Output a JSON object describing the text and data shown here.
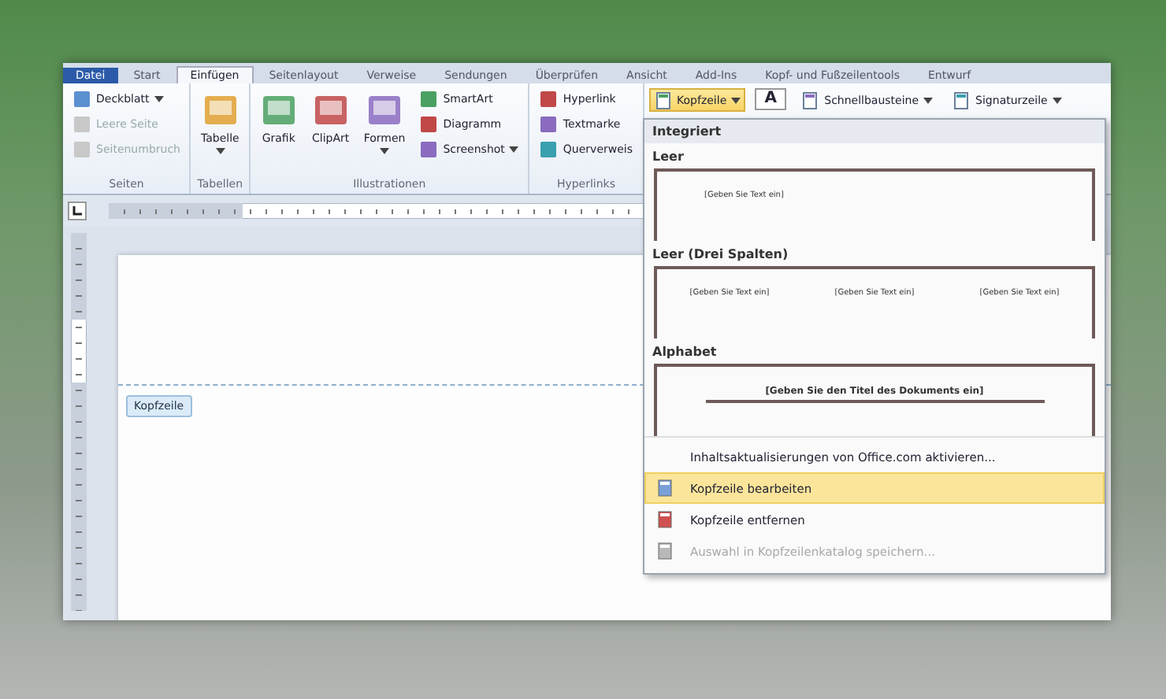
{
  "tabs": [
    {
      "label": "Datei",
      "selected": false
    },
    {
      "label": "Start",
      "selected": false
    },
    {
      "label": "Einfügen",
      "selected": true
    },
    {
      "label": "Seitenlayout",
      "selected": false
    },
    {
      "label": "Verweise",
      "selected": false
    },
    {
      "label": "Sendungen",
      "selected": false
    },
    {
      "label": "Überprüfen",
      "selected": false
    },
    {
      "label": "Ansicht",
      "selected": false
    },
    {
      "label": "Add-Ins",
      "selected": false
    },
    {
      "label": "Kopf- und Fußzeilentools",
      "selected": false
    },
    {
      "label": "Entwurf",
      "selected": false
    }
  ],
  "ribbon": {
    "groups": [
      {
        "label": "Seiten",
        "columns": [
          [
            {
              "label": "Deckblatt",
              "kind": "small",
              "dropdown": true,
              "disabled": false
            },
            {
              "label": "Leere Seite",
              "kind": "small",
              "dropdown": false,
              "disabled": true
            },
            {
              "label": "Seitenumbruch",
              "kind": "small",
              "dropdown": false,
              "disabled": true
            }
          ]
        ]
      },
      {
        "label": "Tabellen",
        "columns": [
          [
            {
              "label": "Tabelle",
              "kind": "large",
              "dropdown": true,
              "disabled": false
            }
          ]
        ]
      },
      {
        "label": "Illustrationen",
        "columns": [
          [
            {
              "label": "Grafik",
              "kind": "large",
              "dropdown": false,
              "disabled": false
            }
          ],
          [
            {
              "label": "ClipArt",
              "kind": "large",
              "dropdown": false,
              "disabled": false
            }
          ],
          [
            {
              "label": "Formen",
              "kind": "large",
              "dropdown": true,
              "disabled": false
            }
          ],
          [
            {
              "label": "SmartArt",
              "kind": "small",
              "dropdown": false,
              "disabled": false
            },
            {
              "label": "Diagramm",
              "kind": "small",
              "dropdown": false,
              "disabled": false
            },
            {
              "label": "Screenshot",
              "kind": "small",
              "dropdown": true,
              "disabled": false
            }
          ]
        ]
      },
      {
        "label": "Hyperlinks",
        "columns": [
          [
            {
              "label": "Hyperlink",
              "kind": "small",
              "dropdown": false,
              "disabled": false
            },
            {
              "label": "Textmarke",
              "kind": "small",
              "dropdown": false,
              "disabled": false
            },
            {
              "label": "Querverweis",
              "kind": "small",
              "dropdown": false,
              "disabled": false
            }
          ]
        ]
      }
    ],
    "header_row": [
      {
        "label": "Kopfzeile",
        "kind": "menu",
        "dropdown": true,
        "selected": true
      },
      {
        "label": "A",
        "kind": "textbox",
        "selected": false
      },
      {
        "label": "Schnellbausteine",
        "kind": "menu",
        "dropdown": true,
        "selected": false
      },
      {
        "label": "Signaturzeile",
        "kind": "menu",
        "dropdown": true,
        "selected": false
      }
    ]
  },
  "page": {
    "header_tag": "Kopfzeile"
  },
  "header_menu": {
    "section": "Integriert",
    "gallery": [
      {
        "name": "Leer",
        "kind": "single",
        "placeholders": [
          "[Geben Sie Text ein]"
        ]
      },
      {
        "name": "Leer (Drei Spalten)",
        "kind": "three",
        "placeholders": [
          "[Geben Sie Text ein]",
          "[Geben Sie Text ein]",
          "[Geben Sie Text ein]"
        ]
      },
      {
        "name": "Alphabet",
        "kind": "title",
        "placeholders": [
          "[Geben Sie den Titel des Dokuments ein]"
        ]
      }
    ],
    "items": [
      {
        "label": "Inhaltsaktualisierungen von Office.com aktivieren...",
        "icon": false,
        "highlighted": false,
        "disabled": false
      },
      {
        "label": "Kopfzeile bearbeiten",
        "icon": true,
        "highlighted": true,
        "disabled": false
      },
      {
        "label": "Kopfzeile entfernen",
        "icon": true,
        "highlighted": false,
        "disabled": false
      },
      {
        "label": "Auswahl in Kopfzeilenkatalog speichern...",
        "icon": true,
        "highlighted": false,
        "disabled": true
      }
    ]
  }
}
